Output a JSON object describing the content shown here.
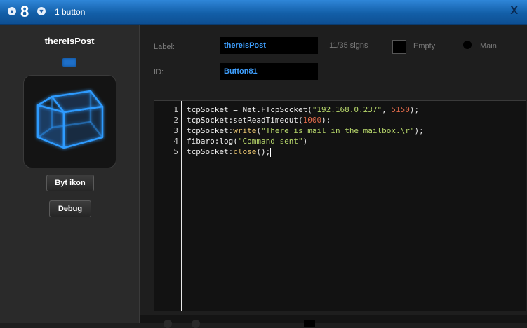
{
  "titlebar": {
    "up_icon": "chevron-up-icon",
    "number": "8",
    "down_icon": "chevron-down-icon",
    "title": "1 button",
    "close_label": "X"
  },
  "sidebar": {
    "device_name": "thereIsPost",
    "change_icon_label": "Byt ikon",
    "debug_label": "Debug"
  },
  "form": {
    "label_caption": "Label:",
    "label_value": "thereIsPost",
    "signs": "11/35 signs",
    "empty_label": "Empty",
    "main_label": "Main",
    "id_caption": "ID:",
    "id_value": "Button81"
  },
  "code": {
    "line_numbers": [
      "1",
      "2",
      "3",
      "4",
      "5"
    ],
    "lines": [
      [
        {
          "t": "tcpSocket = Net.FTcpSocket(",
          "c": "id"
        },
        {
          "t": "\"192.168.0.237\"",
          "c": "str"
        },
        {
          "t": ", ",
          "c": "id"
        },
        {
          "t": "5150",
          "c": "num"
        },
        {
          "t": ");",
          "c": "id"
        }
      ],
      [
        {
          "t": "tcpSocket:setReadTimeout(",
          "c": "id"
        },
        {
          "t": "1000",
          "c": "num"
        },
        {
          "t": ");",
          "c": "id"
        }
      ],
      [
        {
          "t": "tcpSocket:",
          "c": "id"
        },
        {
          "t": "write",
          "c": "fn"
        },
        {
          "t": "(",
          "c": "id"
        },
        {
          "t": "\"There is mail in the mailbox.\\r\"",
          "c": "str"
        },
        {
          "t": ");",
          "c": "id"
        }
      ],
      [
        {
          "t": "fibaro:log(",
          "c": "id"
        },
        {
          "t": "\"Command sent\"",
          "c": "str"
        },
        {
          "t": ")",
          "c": "id"
        }
      ],
      [
        {
          "t": "tcpSocket:",
          "c": "id"
        },
        {
          "t": "close",
          "c": "fn"
        },
        {
          "t": "();",
          "c": "id"
        }
      ]
    ]
  },
  "colors": {
    "titlebar": "#135fa8",
    "accent_text": "#3fa0ff",
    "string": "#b8d86b",
    "number": "#e06a4a",
    "function": "#e6c26e"
  }
}
